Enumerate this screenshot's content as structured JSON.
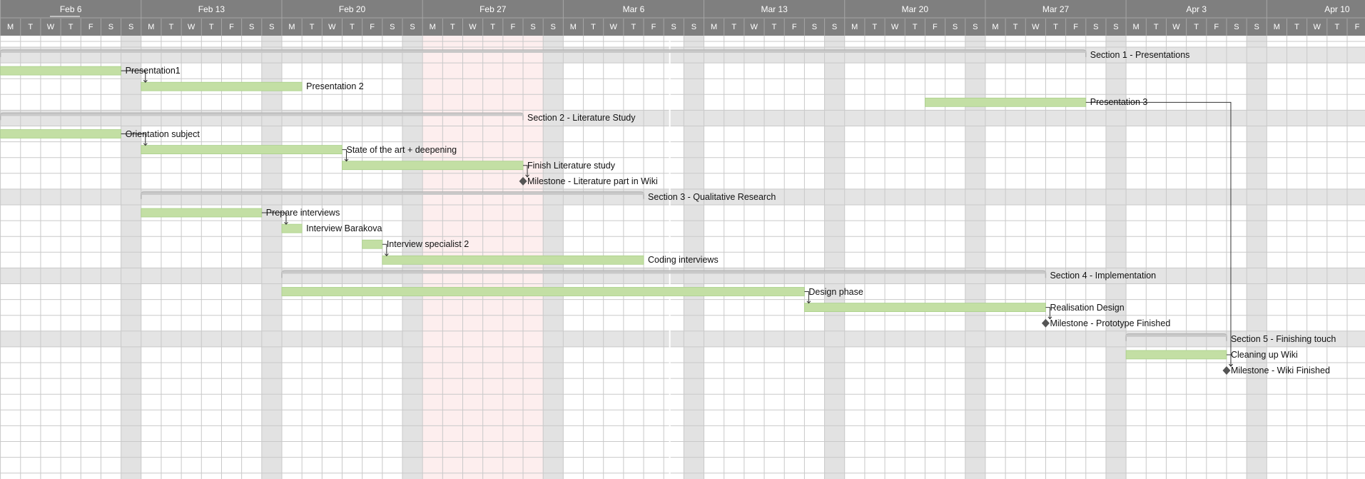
{
  "timeline": {
    "weeks": [
      {
        "label": "Feb 6",
        "date": "2023-02-06"
      },
      {
        "label": "Feb 13",
        "date": "2023-02-13"
      },
      {
        "label": "Feb 20",
        "date": "2023-02-20"
      },
      {
        "label": "Feb 27",
        "date": "2023-02-27"
      },
      {
        "label": "Mar 6",
        "date": "2023-03-06"
      },
      {
        "label": "Mar 13",
        "date": "2023-03-13"
      },
      {
        "label": "Mar 20",
        "date": "2023-03-20"
      },
      {
        "label": "Mar 27",
        "date": "2023-03-27"
      },
      {
        "label": "Apr 3",
        "date": "2023-04-03"
      },
      {
        "label": "Apr 10",
        "date": "2023-04-10"
      }
    ],
    "day_letters": [
      "M",
      "T",
      "W",
      "T",
      "F",
      "S",
      "S"
    ],
    "highlight_range": {
      "start": "2023-02-27",
      "end": "2023-03-04"
    },
    "today": "2023-03-11"
  },
  "colors": {
    "header_bg": "#7f7f7f",
    "bar_fill": "#c3dfa4",
    "bar_edge": "#aad08a",
    "weekend_col": "#e2e2e2",
    "grid_line": "#c9c9c9",
    "section_row_bg": "#e4e4e4",
    "section_bracket": "#c8c8c8",
    "highlight_week": "#fdeeee",
    "milestone": "#555555",
    "dependency_line": "#333333"
  },
  "rows": [
    {
      "kind": "section",
      "label": "Section 1 - Presentations",
      "start": "2023-02-06",
      "end": "2023-03-31"
    },
    {
      "kind": "task",
      "label": "Presentation1",
      "start": "2023-02-06",
      "end": "2023-02-11"
    },
    {
      "kind": "task",
      "label": "Presentation 2",
      "start": "2023-02-13",
      "end": "2023-02-20"
    },
    {
      "kind": "task",
      "label": "Presentation 3",
      "start": "2023-03-24",
      "end": "2023-03-31"
    },
    {
      "kind": "section",
      "label": "Section 2 - Literature Study",
      "start": "2023-02-06",
      "end": "2023-03-03"
    },
    {
      "kind": "task",
      "label": "Orientation subject",
      "start": "2023-02-06",
      "end": "2023-02-11"
    },
    {
      "kind": "task",
      "label": "State of the art + deepening",
      "start": "2023-02-13",
      "end": "2023-02-22"
    },
    {
      "kind": "task",
      "label": "Finish Literature study",
      "start": "2023-02-23",
      "end": "2023-03-03"
    },
    {
      "kind": "milestone",
      "label": "Milestone - Literature part in Wiki",
      "date": "2023-03-03"
    },
    {
      "kind": "section",
      "label": "Section 3 - Qualitative Research",
      "start": "2023-02-13",
      "end": "2023-03-09"
    },
    {
      "kind": "task",
      "label": "Prepare interviews",
      "start": "2023-02-13",
      "end": "2023-02-18"
    },
    {
      "kind": "task",
      "label": "Interview Barakova",
      "start": "2023-02-20",
      "end": "2023-02-20"
    },
    {
      "kind": "task",
      "label": "Interview specialist 2",
      "start": "2023-02-24",
      "end": "2023-02-24"
    },
    {
      "kind": "task",
      "label": "Coding interviews",
      "start": "2023-02-25",
      "end": "2023-03-09"
    },
    {
      "kind": "section",
      "label": "Section 4 - Implementation",
      "start": "2023-02-20",
      "end": "2023-03-29"
    },
    {
      "kind": "task",
      "label": "Design phase",
      "start": "2023-02-20",
      "end": "2023-03-17"
    },
    {
      "kind": "task",
      "label": "Realisation Design",
      "start": "2023-03-18",
      "end": "2023-03-29"
    },
    {
      "kind": "milestone",
      "label": "Milestone - Prototype Finished",
      "date": "2023-03-29"
    },
    {
      "kind": "section",
      "label": "Section 5 - Finishing touch",
      "start": "2023-04-03",
      "end": "2023-04-07"
    },
    {
      "kind": "task",
      "label": "Cleaning up Wiki",
      "start": "2023-04-03",
      "end": "2023-04-07"
    },
    {
      "kind": "milestone",
      "label": "Milestone - Wiki Finished",
      "date": "2023-04-07"
    }
  ],
  "dependencies": [
    {
      "from": "Presentation1",
      "to": "Presentation 2"
    },
    {
      "from": "Orientation subject",
      "to": "State of the art + deepening"
    },
    {
      "from": "State of the art + deepening",
      "to": "Finish Literature study"
    },
    {
      "from": "Finish Literature study",
      "to": "Milestone - Literature part in Wiki"
    },
    {
      "from": "Prepare interviews",
      "to": "Interview Barakova"
    },
    {
      "from": "Interview specialist 2",
      "to": "Coding interviews"
    },
    {
      "from": "Design phase",
      "to": "Realisation Design"
    },
    {
      "from": "Realisation Design",
      "to": "Milestone - Prototype Finished"
    },
    {
      "from": "Presentation 3",
      "to": "Milestone - Wiki Finished"
    },
    {
      "from": "Cleaning up Wiki",
      "to": "Milestone - Wiki Finished"
    }
  ]
}
